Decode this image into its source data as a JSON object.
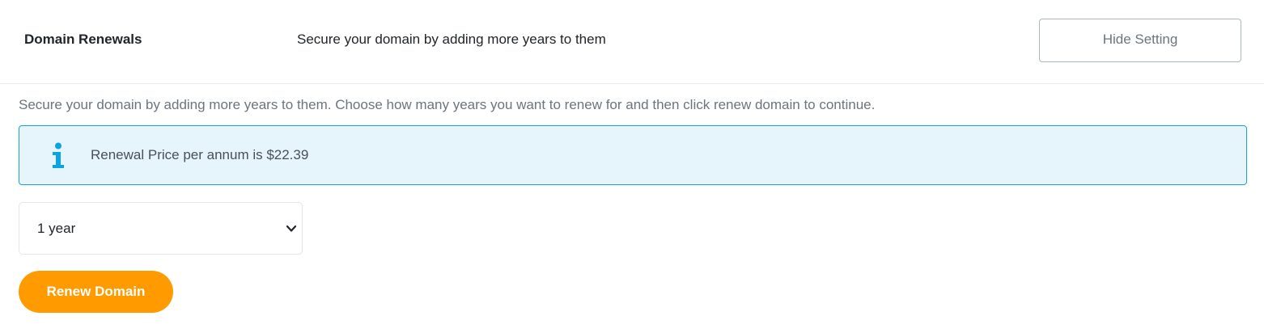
{
  "header": {
    "title": "Domain Renewals",
    "subtitle": "Secure your domain by adding more years to them",
    "hide_button_label": "Hide Setting"
  },
  "description": "Secure your domain by adding more years to them. Choose how many years you want to renew for and then click renew domain to continue.",
  "alert": {
    "icon": "info-icon",
    "text": "Renewal Price per annum is $22.39"
  },
  "renewal_select": {
    "selected_value": "1 year"
  },
  "actions": {
    "renew_label": "Renew Domain"
  },
  "colors": {
    "accent_orange": "#ff9b00",
    "info_background": "#e6f5fc",
    "info_border": "#17a2d8",
    "info_icon": "#0aa4e6"
  }
}
